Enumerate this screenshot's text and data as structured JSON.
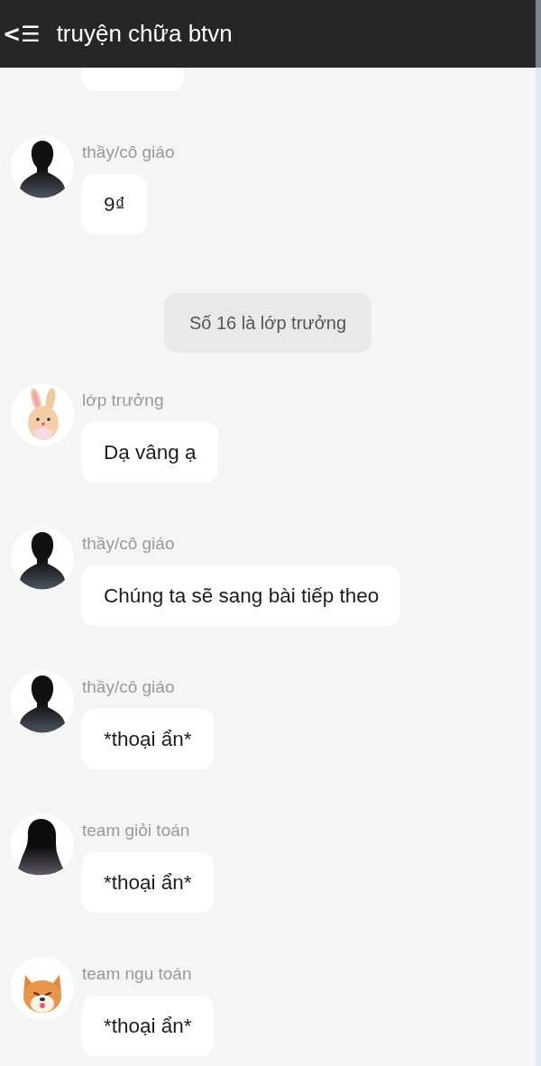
{
  "header": {
    "back_icon": "<☰",
    "title": "truyện chữa btvn"
  },
  "messages": [
    {
      "kind": "hidden-bubble"
    },
    {
      "kind": "message",
      "avatar": {
        "kind": "silhouette"
      },
      "sender": "thầy/cô giáo",
      "text": "9₫"
    },
    {
      "kind": "notice",
      "text": "Số 16 là lớp trưởng"
    },
    {
      "kind": "message",
      "avatar": {
        "kind": "rabbit"
      },
      "sender": "lớp trưởng",
      "text": "Dạ vâng ạ"
    },
    {
      "kind": "message",
      "avatar": {
        "kind": "silhouette"
      },
      "sender": "thầy/cô giáo",
      "text": "Chúng ta sẽ sang bài tiếp theo"
    },
    {
      "kind": "message",
      "avatar": {
        "kind": "silhouette"
      },
      "sender": "thầy/cô giáo",
      "text": "*thoại ẩn*"
    },
    {
      "kind": "message",
      "avatar": {
        "kind": "long-hair"
      },
      "sender": "team giỏi toán",
      "text": "*thoại ẩn*"
    },
    {
      "kind": "message",
      "avatar": {
        "kind": "dog"
      },
      "sender": "team ngu toán",
      "text": "*thoại ẩn*"
    }
  ]
}
